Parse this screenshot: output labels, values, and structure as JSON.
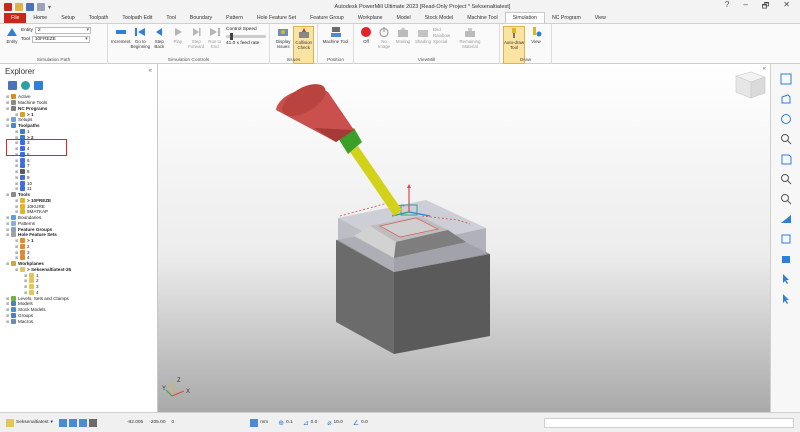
{
  "window": {
    "title": "Autodesk PowerMill Ultimate 2023   [Read-Only Project * Seksenaltiatest]",
    "controls": [
      "?",
      "–",
      "🗗",
      "✕"
    ]
  },
  "tabs": [
    "File",
    "Home",
    "Setup",
    "Toolpath",
    "Toolpath Edit",
    "Tool",
    "Boundary",
    "Pattern",
    "Hole Feature Set",
    "Feature Group",
    "Workplane",
    "Model",
    "Stock Model",
    "Machine Tool",
    "Simulation",
    "NC Program",
    "View"
  ],
  "active_tab": "Simulation",
  "ribbon": {
    "simulation_path": {
      "entity_button": "Entity",
      "entity_label": "Entity",
      "entity_value": "2",
      "tool_label": "Tool",
      "tool_value": "10FREZE",
      "group_label": "Simulation Path"
    },
    "simulation_controls": {
      "increment": "Increment",
      "go_to_beginning": "Go to Beginning",
      "step_back": "Step Back",
      "play": "Play",
      "step_forward": "Step Forward",
      "run_to_end": "Run to End",
      "control_speed_label": "Control Speed",
      "speed_value": "41.0 x feed rate",
      "speed_fraction": 0.12,
      "group_label": "Simulation Controls"
    },
    "issues": {
      "display_issues": "Display Issues",
      "collision_check": "Collision Check",
      "group_label": "Issues"
    },
    "position": {
      "machine_tool": "Machine Tool",
      "group_label": "Position"
    },
    "viewmill": {
      "off": "Off",
      "no_image": "No Image",
      "moving": "Moving",
      "shading": "Shading",
      "shading_options": [
        "Bird",
        "Rainbow",
        "Special"
      ],
      "remaining": "Remaining Material",
      "group_label": "ViewMill"
    },
    "draw": {
      "auto_draw_tool": "Auto-draw Tool",
      "view": "View",
      "group_label": "Draw"
    }
  },
  "explorer": {
    "title": "Explorer",
    "tree": [
      {
        "level": 0,
        "text": "Active",
        "icon": "#d18a2c",
        "bold": false
      },
      {
        "level": 0,
        "text": "Machine Tools",
        "icon": "#8a8a8a",
        "bold": false
      },
      {
        "level": 0,
        "text": "NC Programs",
        "icon": "#7d7d7d",
        "bold": true
      },
      {
        "level": 1,
        "text": "> 1",
        "icon": "#d6a02a",
        "bold": true
      },
      {
        "level": 0,
        "text": "Setups",
        "icon": "#6fa0d8",
        "bold": false
      },
      {
        "level": 0,
        "text": "Toolpaths",
        "icon": "#4f84c6",
        "bold": true
      },
      {
        "level": 1,
        "text": "1",
        "icon": "#2f7ed8",
        "bold": false
      },
      {
        "level": 1,
        "text": "> 2",
        "icon": "#2f7ed8",
        "bold": true
      },
      {
        "level": 1,
        "text": "3",
        "icon": "#3c6ee0",
        "bold": false
      },
      {
        "level": 1,
        "text": "4",
        "icon": "#3c6ee0",
        "bold": false
      },
      {
        "level": 1,
        "text": "5",
        "icon": "#3c6ee0",
        "bold": false
      },
      {
        "level": 1,
        "text": "6",
        "icon": "#3c6ee0",
        "bold": false
      },
      {
        "level": 1,
        "text": "7",
        "icon": "#3c6ee0",
        "bold": false
      },
      {
        "level": 1,
        "text": "8",
        "icon": "#5a5a5a",
        "bold": false
      },
      {
        "level": 1,
        "text": "9",
        "icon": "#3c6ee0",
        "bold": false
      },
      {
        "level": 1,
        "text": "10",
        "icon": "#3c6ee0",
        "bold": false
      },
      {
        "level": 1,
        "text": "11",
        "icon": "#3c6ee0",
        "bold": false
      },
      {
        "level": 0,
        "text": "Tools",
        "icon": "#8a8a8a",
        "bold": true
      },
      {
        "level": 1,
        "text": "> 10FREZE",
        "icon": "#e3b32e",
        "bold": true
      },
      {
        "level": 1,
        "text": "10KURE",
        "icon": "#e3b32e",
        "bold": false
      },
      {
        "level": 1,
        "text": "5MATKAP",
        "icon": "#e3b32e",
        "bold": false
      },
      {
        "level": 0,
        "text": "Boundaries",
        "icon": "#5aa0e0",
        "bold": false
      },
      {
        "level": 0,
        "text": "Patterns",
        "icon": "#8ab0d8",
        "bold": false
      },
      {
        "level": 0,
        "text": "Feature Groups",
        "icon": "#8aa0c0",
        "bold": true
      },
      {
        "level": 0,
        "text": "Hole Feature Sets",
        "icon": "#a0a0a0",
        "bold": true
      },
      {
        "level": 1,
        "text": "> 1",
        "icon": "#e08a2c",
        "bold": true
      },
      {
        "level": 1,
        "text": "2",
        "icon": "#e08a2c",
        "bold": false
      },
      {
        "level": 1,
        "text": "3",
        "icon": "#e08a2c",
        "bold": false
      },
      {
        "level": 1,
        "text": "4",
        "icon": "#e08a2c",
        "bold": false
      },
      {
        "level": 0,
        "text": "Workplanes",
        "icon": "#c9a64a",
        "bold": true
      },
      {
        "level": 1,
        "text": "> Seksenaltiatest-25",
        "icon": "#e3c55a",
        "bold": true
      },
      {
        "level": 2,
        "text": "1",
        "icon": "#e3c55a",
        "bold": false
      },
      {
        "level": 2,
        "text": "2",
        "icon": "#e3c55a",
        "bold": false
      },
      {
        "level": 2,
        "text": "3",
        "icon": "#e3c55a",
        "bold": false
      },
      {
        "level": 2,
        "text": "4",
        "icon": "#e3c55a",
        "bold": false
      },
      {
        "level": 0,
        "text": "Levels, Sets and Clamps",
        "icon": "#6fb04a",
        "bold": false
      },
      {
        "level": 0,
        "text": "Models",
        "icon": "#4a7fc0",
        "bold": false
      },
      {
        "level": 0,
        "text": "Stock Models",
        "icon": "#4a90c0",
        "bold": false
      },
      {
        "level": 0,
        "text": "Groups",
        "icon": "#4a7fc0",
        "bold": false
      },
      {
        "level": 0,
        "text": "Macros",
        "icon": "#6a8ab0",
        "bold": false
      }
    ]
  },
  "viewport": {
    "axis_x": "X",
    "axis_y": "Y",
    "axis_z": "Z"
  },
  "statusbar": {
    "workplane": "Seksenaltiatest",
    "coord_x": "-82.005",
    "coord_y": "-205.00",
    "coord_z": "0",
    "units": "mm",
    "tolerance": "0.1",
    "thickness": "0.0",
    "diameter": "10.0",
    "angle": "0.0"
  }
}
